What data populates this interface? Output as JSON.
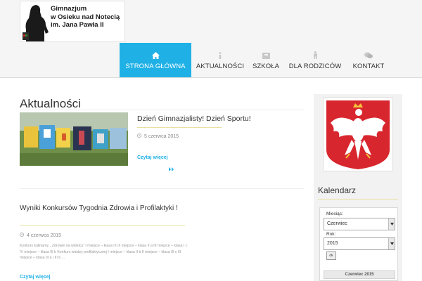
{
  "header": {
    "logo": {
      "lines": [
        "Gimnazjum",
        "w Osieku nad Notecią",
        "im. Jana Pawła II"
      ]
    },
    "nav": [
      {
        "label": "STRONA GŁÓWNA",
        "icon": "home-icon",
        "active": true
      },
      {
        "label": "AKTUALNOŚCI",
        "icon": "info-icon",
        "active": false
      },
      {
        "label": "SZKOŁA",
        "icon": "school-icon",
        "active": false
      },
      {
        "label": "DLA RODZICÓW",
        "icon": "parent-icon",
        "active": false
      },
      {
        "label": "KONTAKT",
        "icon": "chat-icon",
        "active": false
      }
    ]
  },
  "main": {
    "title": "Aktualności",
    "posts": [
      {
        "title": "Dzień Gimnazjalisty! Dzień Sportu!",
        "date": "5 czerwca 2015",
        "more": "Czytaj więcej"
      },
      {
        "title": "Wyniki Konkursów Tygodnia      Zdrowia i Profilaktyki !",
        "date": "4 czerwca 2015",
        "excerpt": "Konkurs kulinarny „ Zdrowie na widelcu”  I miejsce – klasa I b II miejsce – klasa II a III miejsce – klasa I c IV miejsce – klasa III b   Konkurs wiedzy profilaktycznej I miejsce – klasa II b II miejsce – klasa III c III miejsce – klasa III a i III b ...",
        "more": "Czytaj więcej"
      }
    ]
  },
  "sidebar": {
    "widget_title": "Kalendarz",
    "calendar": {
      "month_label": "Miesiąc:",
      "month_value": "Czerwiec",
      "year_label": "Rok:",
      "year_value": "2015",
      "ok_label": "ok",
      "caption": "Czerwiec 2015"
    }
  },
  "colors": {
    "accent": "#1fb1e6",
    "emblem_red": "#d8262e"
  }
}
